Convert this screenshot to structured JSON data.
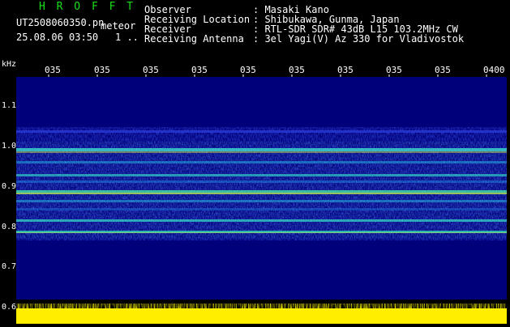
{
  "header": {
    "app_title": "H R O F F T",
    "file_name": "UT2508060350.pn",
    "mode": "meteor",
    "datetime": "25.08.06 03:50",
    "status": "1 .."
  },
  "info": [
    {
      "label": "Observer",
      "value": ": Masaki Kano"
    },
    {
      "label": "Receiving Location",
      "value": ": Shibukawa, Gunma, Japan"
    },
    {
      "label": "Receiver",
      "value": ": RTL-SDR SDR# 43dB L15 103.2MHz CW"
    },
    {
      "label": "Receiving Antenna",
      "value": ": 3el Yagi(V) Az 330 for Vladivostok"
    }
  ],
  "axis": {
    "unit": "kHz",
    "y_ticks": [
      "1.1",
      "1.0",
      "0.9",
      "0.8",
      "0.7",
      "0.6"
    ],
    "x_ticks": [
      "035",
      "035",
      "035",
      "035",
      "035",
      "035",
      "035",
      "035",
      "035",
      "0400"
    ]
  },
  "colors": {
    "background": "#000000",
    "spectrum_bg": "#00007a",
    "title_green": "#19e019",
    "bar_yellow": "#ffee00"
  }
}
